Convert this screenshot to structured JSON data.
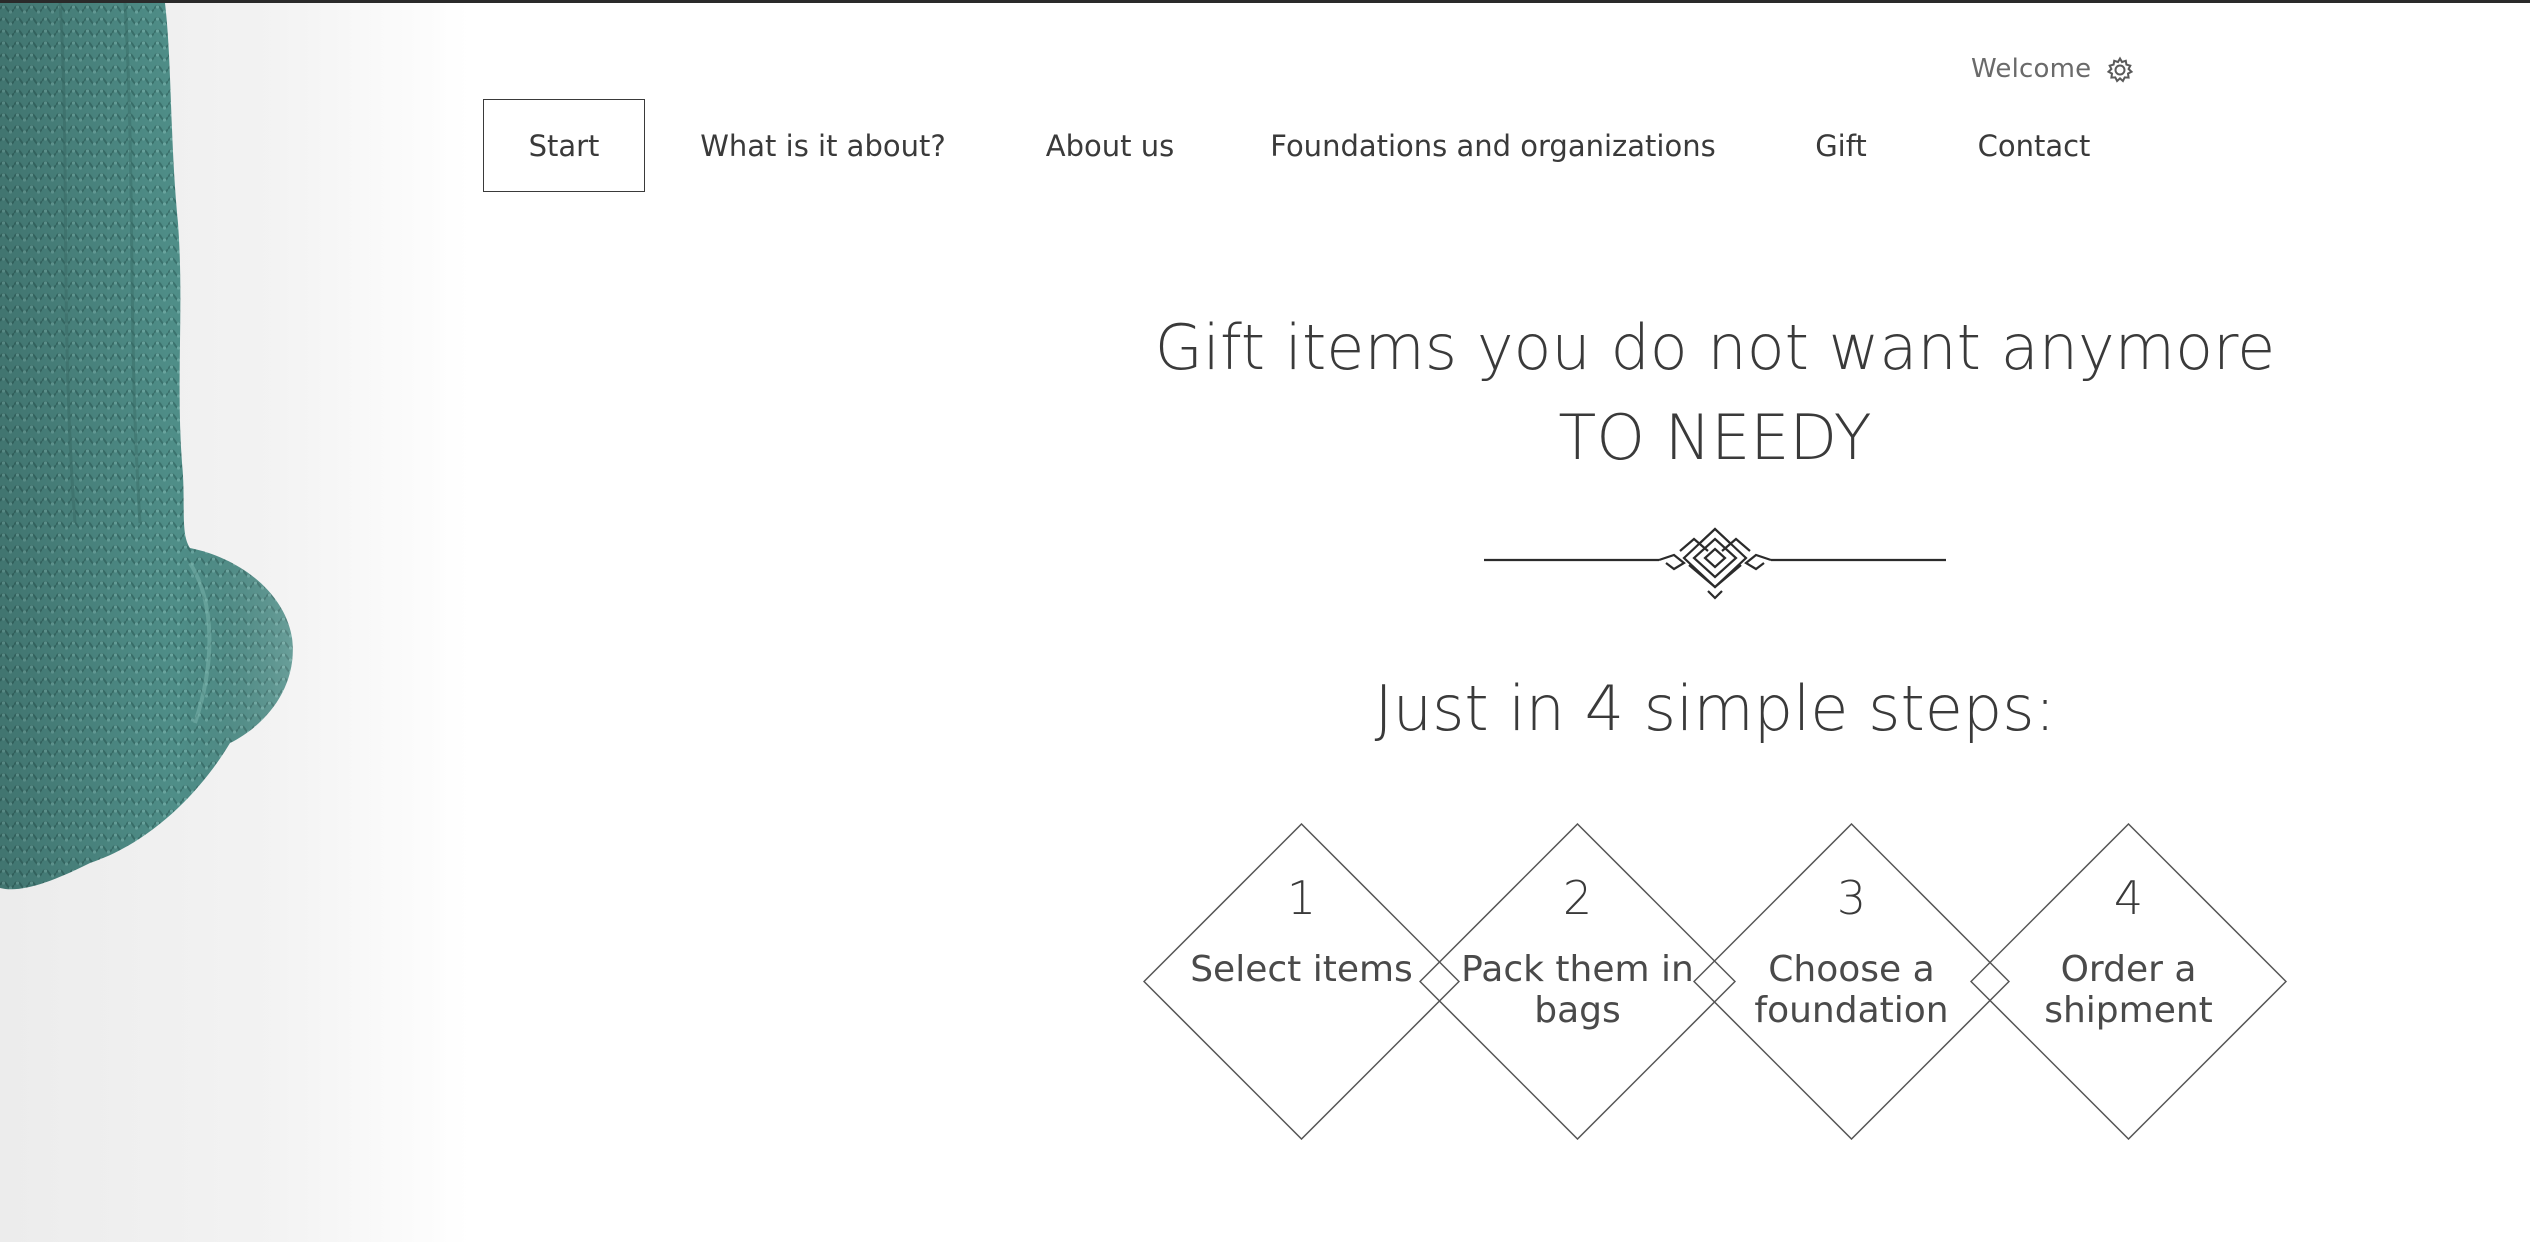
{
  "header": {
    "welcome_text": "Welcome",
    "settings_icon": "gear-icon"
  },
  "nav": {
    "items": [
      {
        "label": "Start",
        "active": true
      },
      {
        "label": "What is it about?",
        "active": false
      },
      {
        "label": "About us",
        "active": false
      },
      {
        "label": "Foundations and organizations",
        "active": false
      },
      {
        "label": "Gift",
        "active": false
      },
      {
        "label": "Contact",
        "active": false
      }
    ]
  },
  "hero": {
    "heading_line1": "Gift items you do not want anymore",
    "heading_line2": "TO NEEDY",
    "ornament_icon": "decoration-ornament"
  },
  "steps": {
    "title": "Just in 4 simple steps:",
    "items": [
      {
        "number": "1",
        "label": "Select items"
      },
      {
        "number": "2",
        "label": "Pack them in bags"
      },
      {
        "number": "3",
        "label": "Choose a foundation"
      },
      {
        "number": "4",
        "label": "Order a shipment"
      }
    ]
  },
  "colors": {
    "text": "#3a3a3a",
    "knit_teal": "#4f8e88",
    "border": "#3a3a3a"
  }
}
